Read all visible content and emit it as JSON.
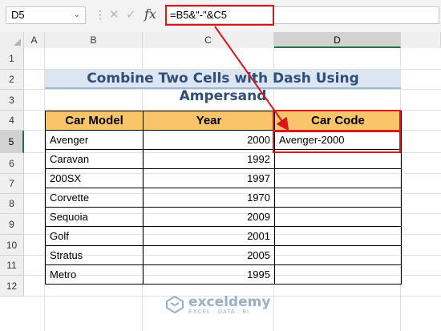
{
  "formula_bar": {
    "name_box": "D5",
    "name_box_dropdown": "⌄",
    "more_icon": "⋮",
    "cancel_icon": "✕",
    "enter_icon": "✓",
    "fx_label": "fx",
    "formula": "=B5&\"-\"&C5"
  },
  "columns": [
    "A",
    "B",
    "C",
    "D"
  ],
  "selected_column": "D",
  "rows": [
    "1",
    "2",
    "3",
    "4",
    "5",
    "6",
    "7",
    "8",
    "9",
    "10",
    "11",
    "12"
  ],
  "selected_row": "5",
  "sheet": {
    "title": "Combine Two Cells with Dash Using Ampersand",
    "headers": [
      "Car Model",
      "Year",
      "Car Code"
    ],
    "data": [
      {
        "model": "Avenger",
        "year": "2000",
        "code": "Avenger-2000"
      },
      {
        "model": "Caravan",
        "year": "1992",
        "code": ""
      },
      {
        "model": "200SX",
        "year": "1997",
        "code": ""
      },
      {
        "model": "Corvette",
        "year": "1970",
        "code": ""
      },
      {
        "model": "Sequoia",
        "year": "2009",
        "code": ""
      },
      {
        "model": "Golf",
        "year": "2001",
        "code": ""
      },
      {
        "model": "Stratus",
        "year": "2005",
        "code": ""
      },
      {
        "model": "Metro",
        "year": "1995",
        "code": ""
      }
    ]
  },
  "watermark": {
    "name": "exceldemy",
    "tagline": "EXCEL · DATA · BI"
  },
  "colors": {
    "accent_red": "#d9161a",
    "header_fill": "#f9c46a",
    "title_fill": "#dce6f2",
    "excel_green": "#217346"
  }
}
